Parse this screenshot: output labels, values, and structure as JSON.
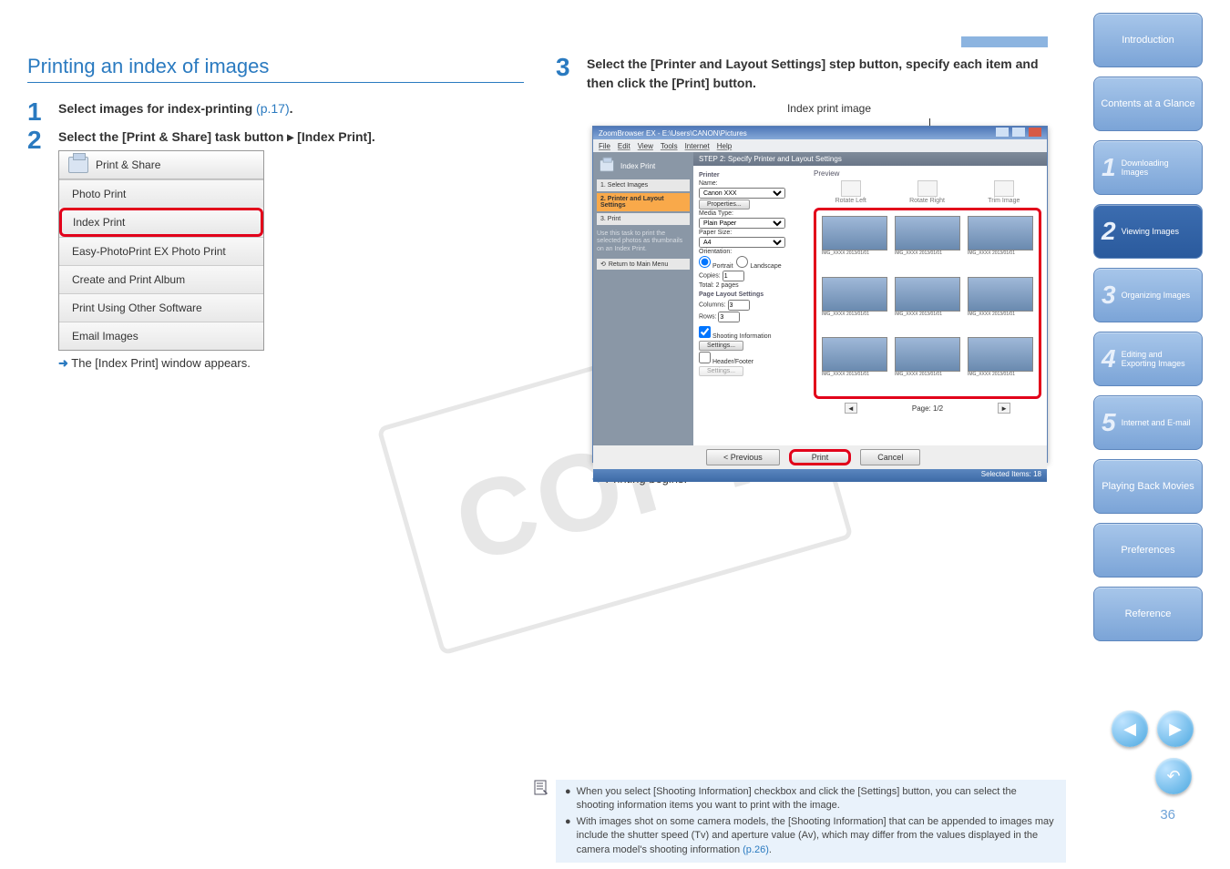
{
  "page_number": "36",
  "watermark": "COPY",
  "section_title": "Printing an index of images",
  "steps": {
    "s1": {
      "num": "1",
      "text_before": "Select images for index-printing ",
      "link": "(p.17)",
      "text_after": "."
    },
    "s2": {
      "num": "2",
      "text": "Select the [Print & Share] task button  ▸  [Index Print]."
    },
    "s2_result": "The [Index Print] window appears.",
    "s3": {
      "num": "3",
      "text": "Select the [Printer and Layout Settings] step button, specify each item and then click the [Print] button."
    },
    "s3_result": "Printing begins.",
    "s3_callout": "Index print image"
  },
  "ps_menu": {
    "header": "Print & Share",
    "items": [
      "Photo Print",
      "Index Print",
      "Easy-PhotoPrint EX Photo Print",
      "Create and Print Album",
      "Print Using Other Software",
      "Email Images"
    ],
    "highlight_index": 1
  },
  "zb": {
    "title": "ZoomBrowser EX - E:\\Users\\CANON\\Pictures",
    "menus": [
      "File",
      "Edit",
      "View",
      "Tools",
      "Internet",
      "Help"
    ],
    "side_header": "Index Print",
    "side_steps": [
      {
        "n": "1",
        "label": "Select Images"
      },
      {
        "n": "2",
        "label": "Printer and Layout Settings"
      },
      {
        "n": "3",
        "label": "Print"
      }
    ],
    "side_tip": "Use this task to print the selected photos as thumbnails on an Index Print.",
    "return": "Return to Main Menu",
    "step_title": "STEP 2: Specify Printer and Layout Settings",
    "printer_grp": "Printer",
    "name_label": "Name:",
    "name_value": "Canon XXX",
    "properties_btn": "Properties...",
    "media_label": "Media Type:",
    "media_value": "Plain Paper",
    "size_label": "Paper Size:",
    "size_value": "A4",
    "orient_label": "Orientation:",
    "orient_portrait": "Portrait",
    "orient_landscape": "Landscape",
    "copies_label": "Copies:",
    "copies_value": "1",
    "total_pages": "Total: 2 pages",
    "layout_grp": "Page Layout Settings",
    "cols_label": "Columns:",
    "cols_value": "3",
    "rows_label": "Rows:",
    "rows_value": "3",
    "shooting_info": "Shooting Information",
    "settings_btn": "Settings...",
    "headerfooter": "Header/Footer",
    "preview_label": "Preview",
    "tool_rotate_left": "Rotate Left",
    "tool_rotate_right": "Rotate Right",
    "tool_trim": "Trim Image",
    "pager": "Page: 1/2",
    "previous_btn": "< Previous",
    "print_btn": "Print",
    "cancel_btn": "Cancel",
    "status": "Selected Items: 18"
  },
  "note": {
    "bullet1": "When you select [Shooting Information] checkbox and click the [Settings] button, you can select the shooting information items you want to print with the image.",
    "bullet2_before": "With images shot on some camera models, the [Shooting Information] that can be appended to images may include the shutter speed (Tv) and aperture value (Av), which may differ from the values displayed in the camera model's shooting information ",
    "bullet2_link": "(p.26)",
    "bullet2_after": "."
  },
  "sidebar": {
    "items": [
      {
        "label": "Introduction"
      },
      {
        "label": "Contents at a Glance"
      },
      {
        "num": "1",
        "label": "Downloading Images"
      },
      {
        "num": "2",
        "label": "Viewing Images"
      },
      {
        "num": "3",
        "label": "Organizing Images"
      },
      {
        "num": "4",
        "label": "Editing and Exporting Images"
      },
      {
        "num": "5",
        "label": "Internet and E-mail"
      },
      {
        "label": "Playing Back Movies"
      },
      {
        "label": "Preferences"
      },
      {
        "label": "Reference"
      }
    ],
    "current_index": 3
  }
}
